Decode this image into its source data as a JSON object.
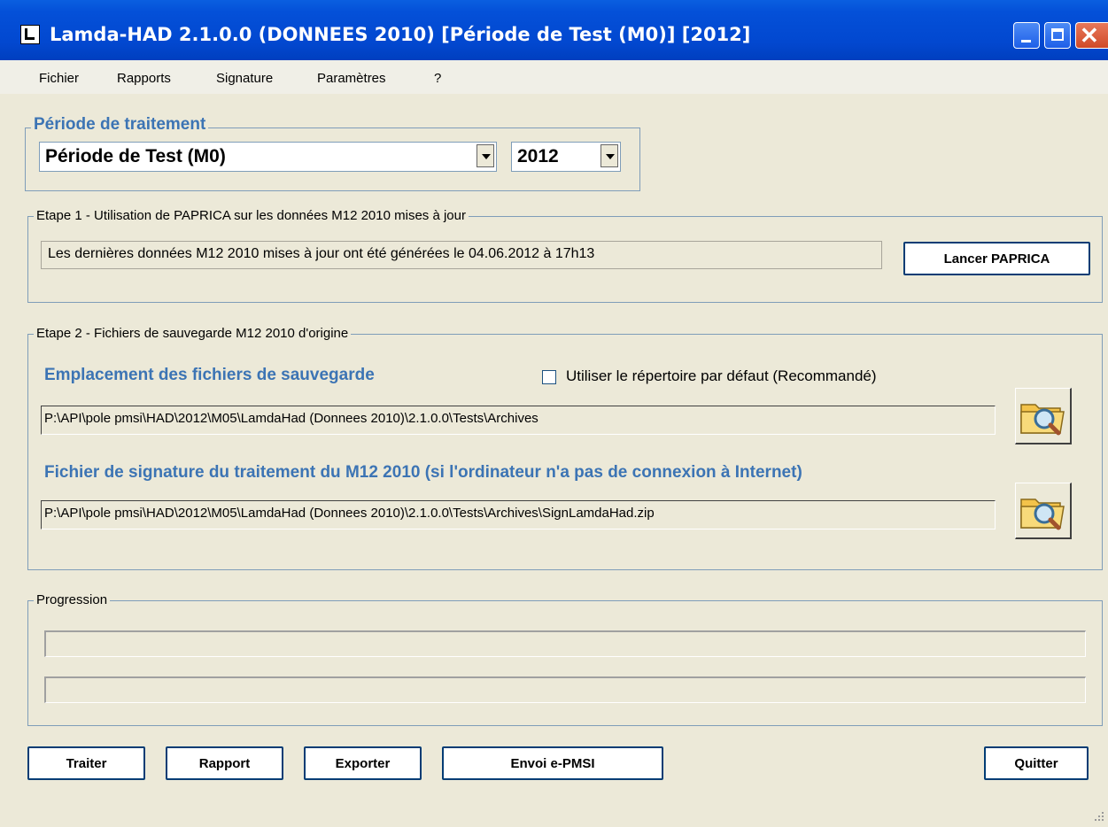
{
  "window": {
    "title": "Lamda-HAD 2.1.0.0 (DONNEES 2010) [Période de Test (M0)] [2012]"
  },
  "menu": [
    "Fichier",
    "Rapports",
    "Signature",
    "Paramètres",
    "?"
  ],
  "periode": {
    "legend": "Période de traitement",
    "period_value": "Période de Test (M0)",
    "year_value": "2012"
  },
  "etape1": {
    "legend": "Etape 1 - Utilisation de PAPRICA sur les données M12 2010 mises à jour",
    "status_text": "Les dernières données M12 2010 mises à jour ont été générées le 04.06.2012 à 17h13",
    "button_label": "Lancer PAPRICA"
  },
  "etape2": {
    "legend": "Etape 2 - Fichiers de sauvegarde M12 2010 d'origine",
    "location_heading": "Emplacement des fichiers de sauvegarde",
    "default_dir_label": "Utiliser le répertoire par défaut (Recommandé)",
    "default_dir_checked": false,
    "location_path": "P:\\API\\pole pmsi\\HAD\\2012\\M05\\LamdaHad (Donnees 2010)\\2.1.0.0\\Tests\\Archives",
    "signature_heading": "Fichier de signature du traitement du M12 2010 (si l'ordinateur n'a pas de connexion à Internet)",
    "signature_path": "P:\\API\\pole pmsi\\HAD\\2012\\M05\\LamdaHad (Donnees 2010)\\2.1.0.0\\Tests\\Archives\\SignLamdaHad.zip"
  },
  "progression": {
    "legend": "Progression",
    "bar1": 0,
    "bar2": 0
  },
  "buttons": {
    "traiter": "Traiter",
    "rapport": "Rapport",
    "exporter": "Exporter",
    "envoi": "Envoi e-PMSI",
    "quitter": "Quitter"
  },
  "colors": {
    "title_bar": "#0450D8",
    "heading_blue": "#3C74B4",
    "window_bg": "#ECE9D8"
  }
}
